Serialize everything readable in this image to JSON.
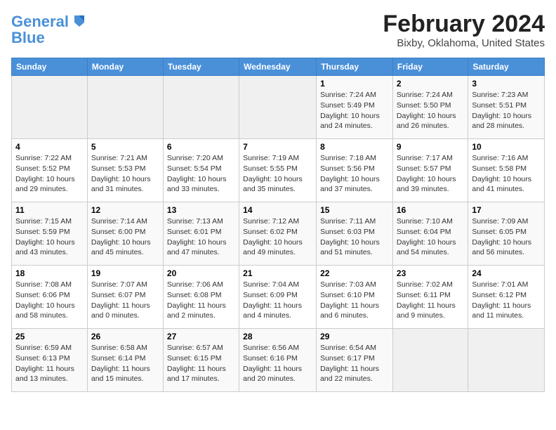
{
  "header": {
    "logo_line1": "General",
    "logo_line2": "Blue",
    "month_year": "February 2024",
    "location": "Bixby, Oklahoma, United States"
  },
  "weekdays": [
    "Sunday",
    "Monday",
    "Tuesday",
    "Wednesday",
    "Thursday",
    "Friday",
    "Saturday"
  ],
  "weeks": [
    [
      {
        "num": "",
        "info": ""
      },
      {
        "num": "",
        "info": ""
      },
      {
        "num": "",
        "info": ""
      },
      {
        "num": "",
        "info": ""
      },
      {
        "num": "1",
        "info": "Sunrise: 7:24 AM\nSunset: 5:49 PM\nDaylight: 10 hours\nand 24 minutes."
      },
      {
        "num": "2",
        "info": "Sunrise: 7:24 AM\nSunset: 5:50 PM\nDaylight: 10 hours\nand 26 minutes."
      },
      {
        "num": "3",
        "info": "Sunrise: 7:23 AM\nSunset: 5:51 PM\nDaylight: 10 hours\nand 28 minutes."
      }
    ],
    [
      {
        "num": "4",
        "info": "Sunrise: 7:22 AM\nSunset: 5:52 PM\nDaylight: 10 hours\nand 29 minutes."
      },
      {
        "num": "5",
        "info": "Sunrise: 7:21 AM\nSunset: 5:53 PM\nDaylight: 10 hours\nand 31 minutes."
      },
      {
        "num": "6",
        "info": "Sunrise: 7:20 AM\nSunset: 5:54 PM\nDaylight: 10 hours\nand 33 minutes."
      },
      {
        "num": "7",
        "info": "Sunrise: 7:19 AM\nSunset: 5:55 PM\nDaylight: 10 hours\nand 35 minutes."
      },
      {
        "num": "8",
        "info": "Sunrise: 7:18 AM\nSunset: 5:56 PM\nDaylight: 10 hours\nand 37 minutes."
      },
      {
        "num": "9",
        "info": "Sunrise: 7:17 AM\nSunset: 5:57 PM\nDaylight: 10 hours\nand 39 minutes."
      },
      {
        "num": "10",
        "info": "Sunrise: 7:16 AM\nSunset: 5:58 PM\nDaylight: 10 hours\nand 41 minutes."
      }
    ],
    [
      {
        "num": "11",
        "info": "Sunrise: 7:15 AM\nSunset: 5:59 PM\nDaylight: 10 hours\nand 43 minutes."
      },
      {
        "num": "12",
        "info": "Sunrise: 7:14 AM\nSunset: 6:00 PM\nDaylight: 10 hours\nand 45 minutes."
      },
      {
        "num": "13",
        "info": "Sunrise: 7:13 AM\nSunset: 6:01 PM\nDaylight: 10 hours\nand 47 minutes."
      },
      {
        "num": "14",
        "info": "Sunrise: 7:12 AM\nSunset: 6:02 PM\nDaylight: 10 hours\nand 49 minutes."
      },
      {
        "num": "15",
        "info": "Sunrise: 7:11 AM\nSunset: 6:03 PM\nDaylight: 10 hours\nand 51 minutes."
      },
      {
        "num": "16",
        "info": "Sunrise: 7:10 AM\nSunset: 6:04 PM\nDaylight: 10 hours\nand 54 minutes."
      },
      {
        "num": "17",
        "info": "Sunrise: 7:09 AM\nSunset: 6:05 PM\nDaylight: 10 hours\nand 56 minutes."
      }
    ],
    [
      {
        "num": "18",
        "info": "Sunrise: 7:08 AM\nSunset: 6:06 PM\nDaylight: 10 hours\nand 58 minutes."
      },
      {
        "num": "19",
        "info": "Sunrise: 7:07 AM\nSunset: 6:07 PM\nDaylight: 11 hours\nand 0 minutes."
      },
      {
        "num": "20",
        "info": "Sunrise: 7:06 AM\nSunset: 6:08 PM\nDaylight: 11 hours\nand 2 minutes."
      },
      {
        "num": "21",
        "info": "Sunrise: 7:04 AM\nSunset: 6:09 PM\nDaylight: 11 hours\nand 4 minutes."
      },
      {
        "num": "22",
        "info": "Sunrise: 7:03 AM\nSunset: 6:10 PM\nDaylight: 11 hours\nand 6 minutes."
      },
      {
        "num": "23",
        "info": "Sunrise: 7:02 AM\nSunset: 6:11 PM\nDaylight: 11 hours\nand 9 minutes."
      },
      {
        "num": "24",
        "info": "Sunrise: 7:01 AM\nSunset: 6:12 PM\nDaylight: 11 hours\nand 11 minutes."
      }
    ],
    [
      {
        "num": "25",
        "info": "Sunrise: 6:59 AM\nSunset: 6:13 PM\nDaylight: 11 hours\nand 13 minutes."
      },
      {
        "num": "26",
        "info": "Sunrise: 6:58 AM\nSunset: 6:14 PM\nDaylight: 11 hours\nand 15 minutes."
      },
      {
        "num": "27",
        "info": "Sunrise: 6:57 AM\nSunset: 6:15 PM\nDaylight: 11 hours\nand 17 minutes."
      },
      {
        "num": "28",
        "info": "Sunrise: 6:56 AM\nSunset: 6:16 PM\nDaylight: 11 hours\nand 20 minutes."
      },
      {
        "num": "29",
        "info": "Sunrise: 6:54 AM\nSunset: 6:17 PM\nDaylight: 11 hours\nand 22 minutes."
      },
      {
        "num": "",
        "info": ""
      },
      {
        "num": "",
        "info": ""
      }
    ]
  ]
}
